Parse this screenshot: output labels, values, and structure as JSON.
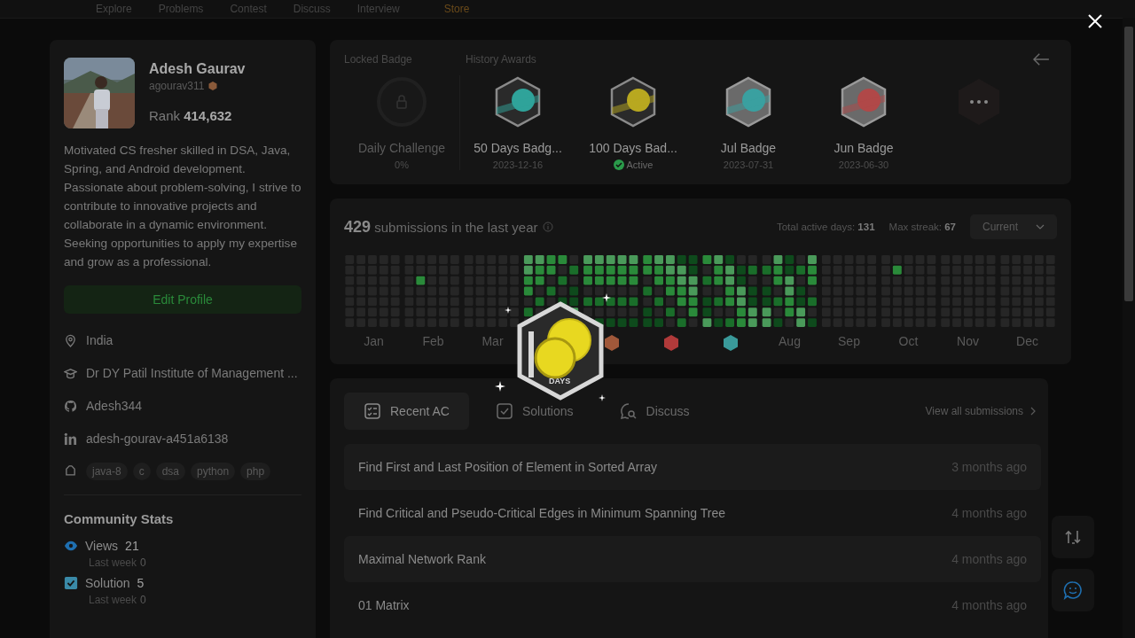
{
  "nav": [
    "Explore",
    "Problems",
    "Contest",
    "Discuss",
    "Interview",
    "Store"
  ],
  "profile": {
    "name": "Adesh Gaurav",
    "username": "agourav311",
    "rank_label": "Rank",
    "rank": "414,632",
    "bio": "Motivated CS fresher skilled in DSA, Java, Spring, and Android development. Passionate about problem-solving, I strive to contribute to innovative projects and collaborate in a dynamic environment. Seeking opportunities to apply my expertise and grow as a professional.",
    "edit_button": "Edit Profile",
    "details": [
      {
        "kind": "location",
        "text": "India"
      },
      {
        "kind": "school",
        "text": "Dr DY Patil Institute of Management ..."
      },
      {
        "kind": "github",
        "text": "Adesh344"
      },
      {
        "kind": "linkedin",
        "text": "adesh-gourav-a451a6138"
      }
    ],
    "skills": [
      "java-8",
      "c",
      "dsa",
      "python",
      "php"
    ]
  },
  "community_stats": {
    "title": "Community Stats",
    "items": [
      {
        "kind": "views",
        "label": "Views",
        "value": "21",
        "sub_label": "Last week",
        "sub_value": "0"
      },
      {
        "kind": "solution",
        "label": "Solution",
        "value": "5",
        "sub_label": "Last week",
        "sub_value": "0"
      }
    ]
  },
  "badges": {
    "locked_label": "Locked Badge",
    "history_label": "History Awards",
    "items": [
      {
        "kind": "locked",
        "name": "Daily Challenge",
        "sub": "0%",
        "active": false
      },
      {
        "kind": "days50",
        "name": "50 Days Badg...",
        "sub": "2023-12-16",
        "active": false
      },
      {
        "kind": "days100",
        "name": "100 Days Bad...",
        "sub": "Active",
        "active": true
      },
      {
        "kind": "jul",
        "name": "Jul Badge",
        "sub": "2023-07-31",
        "active": false
      },
      {
        "kind": "jun",
        "name": "Jun Badge",
        "sub": "2023-06-30",
        "active": false
      },
      {
        "kind": "more"
      }
    ]
  },
  "calendar": {
    "count": "429",
    "text": "submissions in the last year",
    "total_label": "Total active days:",
    "total": "131",
    "streak_label": "Max streak:",
    "streak": "67",
    "dropdown": "Current",
    "months": [
      {
        "kind": "label",
        "text": "Jan"
      },
      {
        "kind": "label",
        "text": "Feb"
      },
      {
        "kind": "label",
        "text": "Mar"
      },
      {
        "kind": "badge",
        "color": "#a0583a"
      },
      {
        "kind": "badge",
        "color": "#b03a3a"
      },
      {
        "kind": "badge",
        "color": "#3a9a9a"
      },
      {
        "kind": "label",
        "text": "Aug"
      },
      {
        "kind": "label",
        "text": "Sep"
      },
      {
        "kind": "label",
        "text": "Oct"
      },
      {
        "kind": "label",
        "text": "Nov"
      },
      {
        "kind": "label",
        "text": "Dec"
      }
    ]
  },
  "tabs": [
    {
      "kind": "recent",
      "label": "Recent AC",
      "selected": true
    },
    {
      "kind": "solutions",
      "label": "Solutions",
      "selected": false
    },
    {
      "kind": "discuss",
      "label": "Discuss",
      "selected": false
    }
  ],
  "view_all": "View all submissions",
  "submissions": [
    {
      "title": "Find First and Last Position of Element in Sorted Array",
      "time": "3 months ago"
    },
    {
      "title": "Find Critical and Pseudo-Critical Edges in Minimum Spanning Tree",
      "time": "4 months ago"
    },
    {
      "title": "Maximal Network Rank",
      "time": "4 months ago"
    },
    {
      "title": "01 Matrix",
      "time": "4 months ago"
    }
  ],
  "popup": {
    "caption": "DAYS"
  }
}
